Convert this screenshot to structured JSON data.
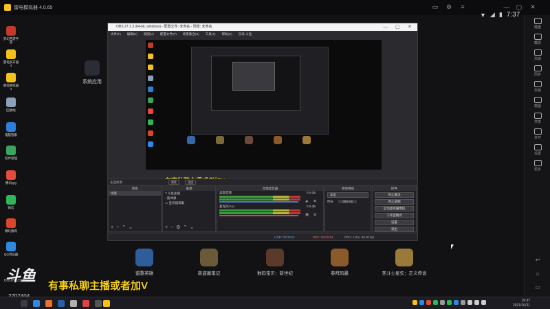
{
  "emulator": {
    "title": "雷电模拟器 4.0.65",
    "status_time": "7:37"
  },
  "right_bar": {
    "items": [
      "键盘",
      "截屏",
      "加速",
      "同步",
      "安装",
      "截图",
      "共享",
      "多开",
      "设置",
      "更多"
    ]
  },
  "desktop_icons": [
    "梦幻西游手游",
    "雷电多开器4",
    "雷电模拟器4",
    "回收站",
    "电脑管家",
    "软件管理",
    "腾讯QQ",
    "微信",
    "哪吒教育",
    "QQ浏览器"
  ],
  "system_app": "系统应用",
  "obs": {
    "title": "OBS 27.1.3 (64-bit, windows) - 配置文件: 未命名 - 场景: 未命名",
    "menu": [
      "文件(F)",
      "编辑(E)",
      "视图(V)",
      "配置文件(P)",
      "场景集合(S)",
      "工具(T)",
      "帮助(H)",
      "乐高·斗鱼"
    ],
    "preview_banner": "有事私聊主播或者加V",
    "selection_bar": "未选择源",
    "btn_properties": "属性",
    "btn_filters": "滤镜",
    "scenes_header": "场景",
    "scenes": [
      "场景"
    ],
    "sources_header": "来源",
    "sources": [
      "斗鱼主播",
      "肢体源",
      "显示器采集"
    ],
    "mixer_header": "音频混音器",
    "mixer": [
      {
        "name": "桌面音频",
        "db": "0.0 dB"
      },
      {
        "name": "麦克风/Aux",
        "db": "0.0 dB"
      }
    ],
    "transitions_header": "转场特效",
    "transition_value": "淡出",
    "duration_label": "时长",
    "duration_value": "300 ms",
    "controls_header": "控件",
    "controls": [
      "停止推流",
      "停止录制",
      "启动虚拟摄像机",
      "工作室模式",
      "设置",
      "退出"
    ],
    "status": {
      "live": "LIVE: 00:00:51",
      "rec": "REC: 00:00:52",
      "cpu": "CPU: 1.0%, 60.00 fps"
    }
  },
  "apps": [
    "盟重英雄",
    "新盗墓笔记",
    "数码宝贝：新世纪",
    "参拜风暴",
    "圣斗士星矢：正义传说"
  ],
  "overlay": {
    "banner": "有事私聊主播或者加V",
    "logo": "斗鱼",
    "logo_sub": "DOUYU.COM",
    "room_id": "2707404"
  },
  "taskbar": {
    "clock_time": "19:37",
    "clock_date": "2021/10/21"
  },
  "colors": {
    "accent_yellow": "#f5d11a",
    "obs_bg": "#2b2b2f",
    "live_red": "#c84a4a"
  }
}
